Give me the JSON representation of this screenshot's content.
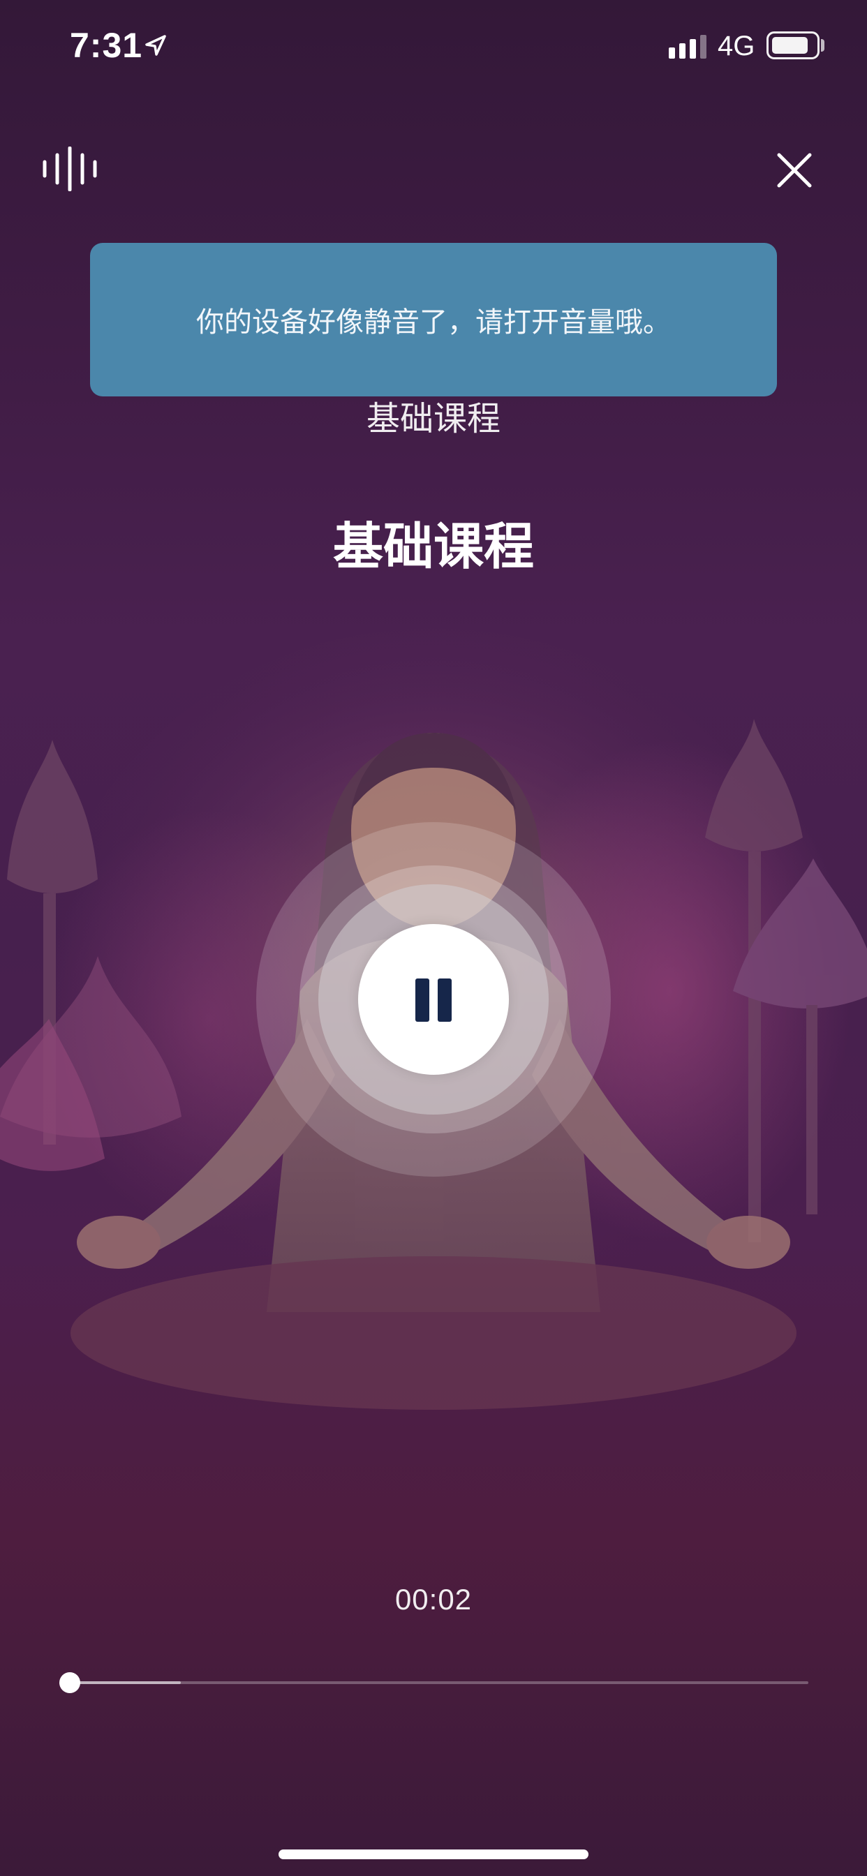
{
  "status_bar": {
    "time": "7:31",
    "network": "4G"
  },
  "toast": {
    "message": "你的设备好像静音了，请打开音量哦。"
  },
  "course": {
    "subtitle": "基础课程",
    "title": "基础课程"
  },
  "player": {
    "state": "playing",
    "elapsed": "00:02",
    "progress_fraction": 0.15
  },
  "icons": {
    "sound": "sound-wave-icon",
    "close": "close-icon",
    "control": "pause-icon"
  },
  "colors": {
    "toast_bg": "#4b87ab",
    "pause_glyph": "#16264a",
    "background_top": "#331838",
    "background_bottom": "#3b1a39"
  }
}
